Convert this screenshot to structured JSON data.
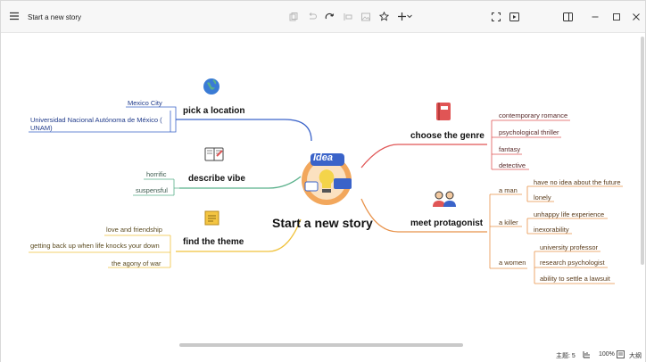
{
  "window": {
    "title": "Start a new story"
  },
  "central": {
    "title": "Start a new story",
    "badge": "Idea"
  },
  "branches": {
    "location": {
      "label": "pick a location",
      "leaves": [
        "Mexico City",
        "Universidad Nacional Autónoma de México (",
        "UNAM)"
      ]
    },
    "vibe": {
      "label": "describe vibe",
      "leaves": [
        "horrific",
        "suspensful"
      ]
    },
    "theme": {
      "label": "find the theme",
      "leaves": [
        "love and friendship",
        "getting back up when life knocks your down",
        "the agony of war"
      ]
    },
    "genre": {
      "label": "choose the genre",
      "leaves": [
        "contemporary romance",
        "psychological thriller",
        "fantasy",
        "detective"
      ]
    },
    "protagonist": {
      "label": "meet protagonist",
      "groups": [
        {
          "label": "a  man",
          "leaves": [
            "have no idea about the future",
            "lonely"
          ]
        },
        {
          "label": "a  killer",
          "leaves": [
            "unhappy life experience",
            "inexorability"
          ]
        },
        {
          "label": "a women",
          "leaves": [
            "university professor",
            "research psychologist",
            "ability to settle a lawsuit"
          ]
        }
      ]
    }
  },
  "statusbar": {
    "topic_count": "主题: 5",
    "zoom": "100%",
    "outline": "大纲"
  },
  "colors": {
    "blue": "#3a63c9",
    "green": "#58b08a",
    "yellow": "#f0c23c",
    "red": "#e05555",
    "orange": "#e8924a"
  },
  "icons": [
    "menu-icon",
    "copy-icon",
    "undo-icon",
    "redo-icon",
    "insert-icon",
    "image-icon",
    "star-icon",
    "add-icon",
    "chevron-down-icon",
    "fullscreen-icon",
    "play-icon",
    "sidebar-icon",
    "minimize-icon",
    "maximize-icon",
    "close-icon",
    "globe-icon",
    "notebook-icon",
    "sticky-note-icon",
    "book-icon",
    "people-icon",
    "idea-bulb-icon",
    "outline-icon",
    "zoom-icon"
  ]
}
